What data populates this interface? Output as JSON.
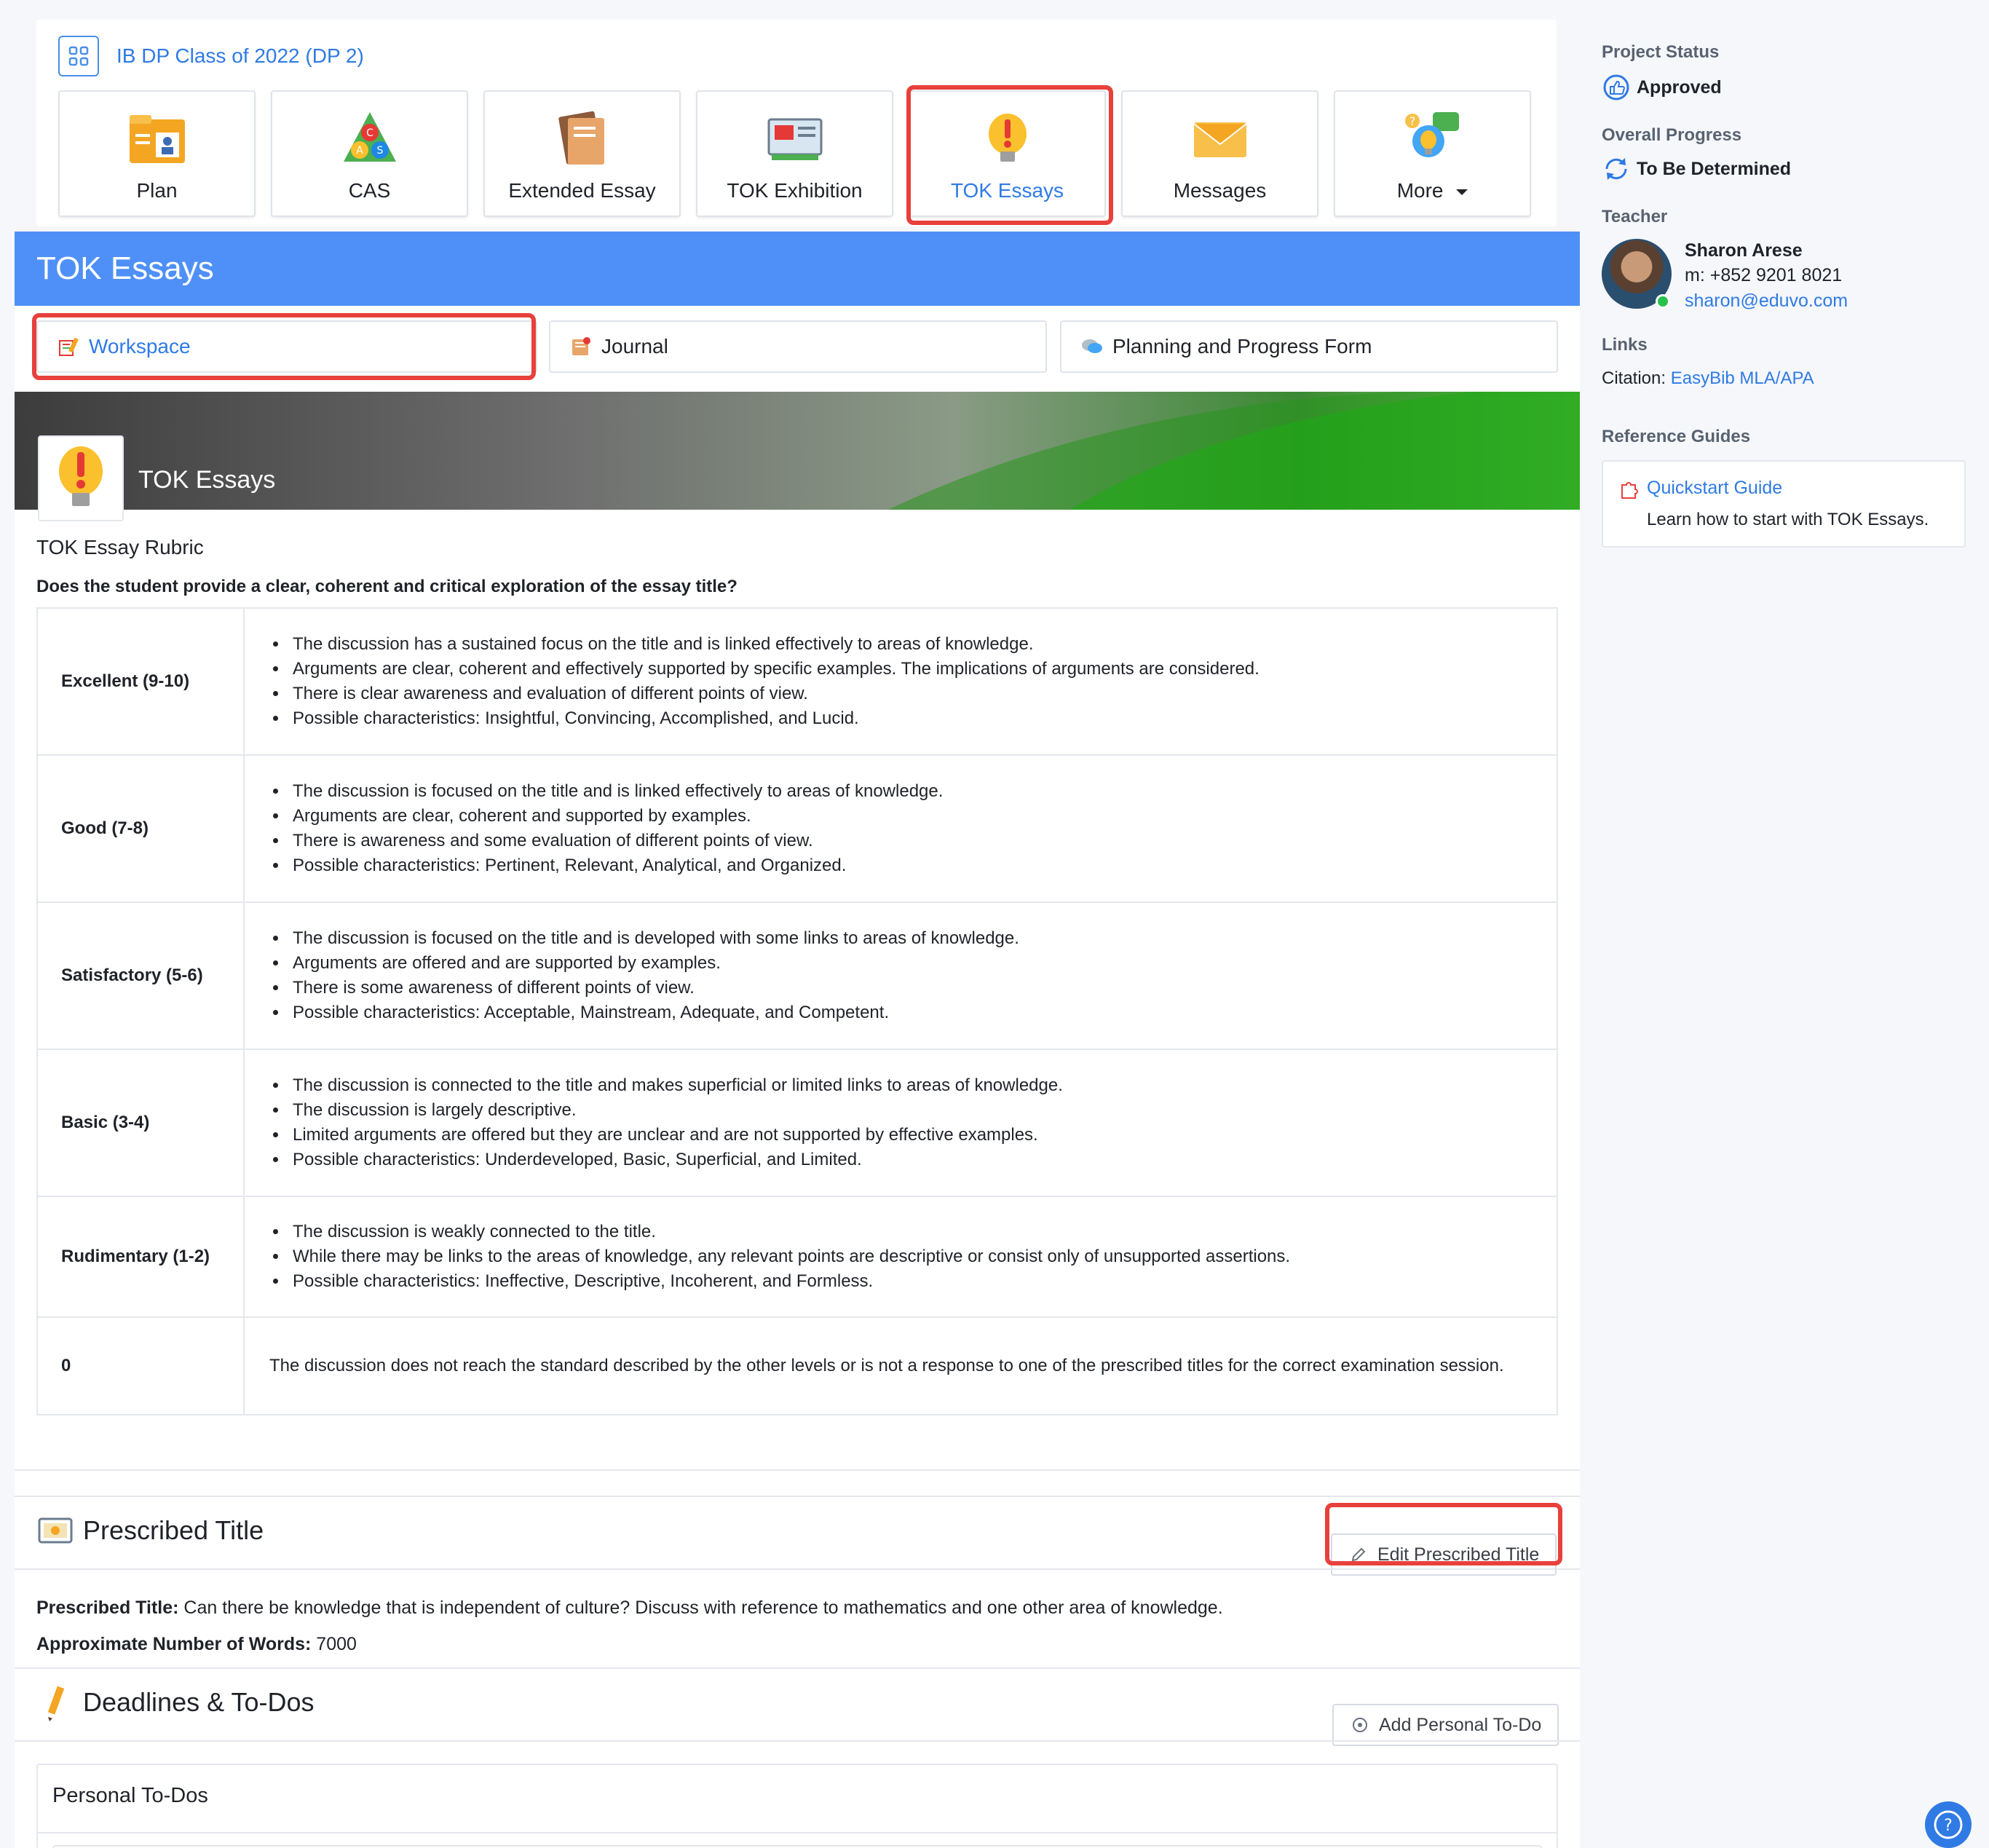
{
  "header": {
    "class_name": "IB DP Class of 2022 (DP 2)",
    "tabs": [
      {
        "label": "Plan",
        "icon": "plan-folder-icon"
      },
      {
        "label": "CAS",
        "icon": "cas-triangle-icon"
      },
      {
        "label": "Extended Essay",
        "icon": "extended-essay-book-icon"
      },
      {
        "label": "TOK Exhibition",
        "icon": "tok-exhibition-icon"
      },
      {
        "label": "TOK Essays",
        "icon": "lightbulb-exclamation-icon",
        "active": true
      },
      {
        "label": "Messages",
        "icon": "envelope-icon"
      },
      {
        "label": "More",
        "icon": "lightbulb-chat-icon"
      }
    ]
  },
  "page": {
    "title": "TOK Essays",
    "subtabs": [
      {
        "label": "Workspace",
        "active": true
      },
      {
        "label": "Journal"
      },
      {
        "label": "Planning and Progress Form"
      }
    ],
    "hero_title": "TOK Essays"
  },
  "rubric": {
    "title": "TOK Essay Rubric",
    "question": "Does the student provide a clear, coherent and critical exploration of the essay title?",
    "rows": [
      {
        "level": "Excellent (9-10)",
        "points": [
          "The discussion has a sustained focus on the title and is linked effectively to areas of knowledge.",
          "Arguments are clear, coherent and effectively supported by specific examples. The implications of arguments are considered.",
          "There is clear awareness and evaluation of different points of view.",
          "Possible characteristics: Insightful, Convincing, Accomplished, and Lucid."
        ]
      },
      {
        "level": "Good (7-8)",
        "points": [
          "The discussion is focused on the title and is linked effectively to areas of knowledge.",
          "Arguments are clear, coherent and supported by examples.",
          "There is awareness and some evaluation of different points of view.",
          "Possible characteristics: Pertinent, Relevant, Analytical, and Organized."
        ]
      },
      {
        "level": "Satisfactory (5-6)",
        "points": [
          "The discussion is focused on the title and is developed with some links to areas of knowledge.",
          "Arguments are offered and are supported by examples.",
          "There is some awareness of different points of view.",
          "Possible characteristics: Acceptable, Mainstream, Adequate, and Competent."
        ]
      },
      {
        "level": "Basic (3-4)",
        "points": [
          "The discussion is connected to the title and makes superficial or limited links to areas of knowledge.",
          "The discussion is largely descriptive.",
          "Limited arguments are offered but they are unclear and are not supported by effective examples.",
          "Possible characteristics: Underdeveloped, Basic, Superficial, and Limited."
        ]
      },
      {
        "level": "Rudimentary (1-2)",
        "points": [
          "The discussion is weakly connected to the title.",
          "While there may be links to the areas of knowledge, any relevant points are descriptive or consist only of unsupported assertions.",
          "Possible characteristics: Ineffective, Descriptive, Incoherent, and Formless."
        ]
      },
      {
        "level": "0",
        "text": "The discussion does not reach the standard described by the other levels or is not a response to one of the prescribed titles for the correct examination session."
      }
    ]
  },
  "prescribed": {
    "heading": "Prescribed Title",
    "edit_label": "Edit Prescribed Title",
    "title_label": "Prescribed Title:",
    "title_value": "Can there be knowledge that is independent of culture? Discuss with reference to mathematics and one other area of knowledge.",
    "words_label": "Approximate Number of Words:",
    "words_value": "7000"
  },
  "deadlines": {
    "heading": "Deadlines & To-Dos",
    "add_label": "Add Personal To-Do",
    "personal_title": "Personal To-Dos"
  },
  "sidebar": {
    "project_status_label": "Project Status",
    "project_status_value": "Approved",
    "overall_progress_label": "Overall Progress",
    "overall_progress_value": "To Be Determined",
    "teacher_label": "Teacher",
    "teacher_name": "Sharon Arese",
    "teacher_phone": "m: +852 9201 8021",
    "teacher_email": "sharon@eduvo.com",
    "links_label": "Links",
    "citation_label": "Citation:",
    "citation_link": "EasyBib MLA/APA",
    "reference_label": "Reference Guides",
    "guide_title": "Quickstart Guide",
    "guide_desc": "Learn how to start with TOK Essays."
  },
  "help": {
    "icon": "help-question-icon"
  },
  "colors": {
    "accent": "#2f7ae5",
    "banner": "#4e90f7",
    "highlight": "#e8403b",
    "online": "#27c24c"
  }
}
